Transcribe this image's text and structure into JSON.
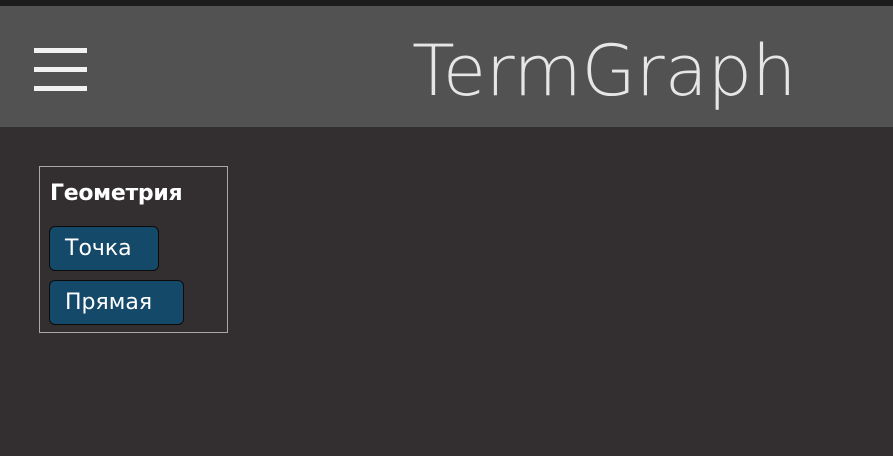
{
  "header": {
    "title": "TermGraph",
    "menu_icon": "hamburger-menu-icon"
  },
  "geometry_panel": {
    "title": "Геометрия",
    "buttons": [
      {
        "label": "Точка"
      },
      {
        "label": "Прямая"
      }
    ]
  },
  "colors": {
    "background": "#332f30",
    "header_background": "#525252",
    "button_background": "#15496a",
    "title_text": "#e6e6e6"
  }
}
